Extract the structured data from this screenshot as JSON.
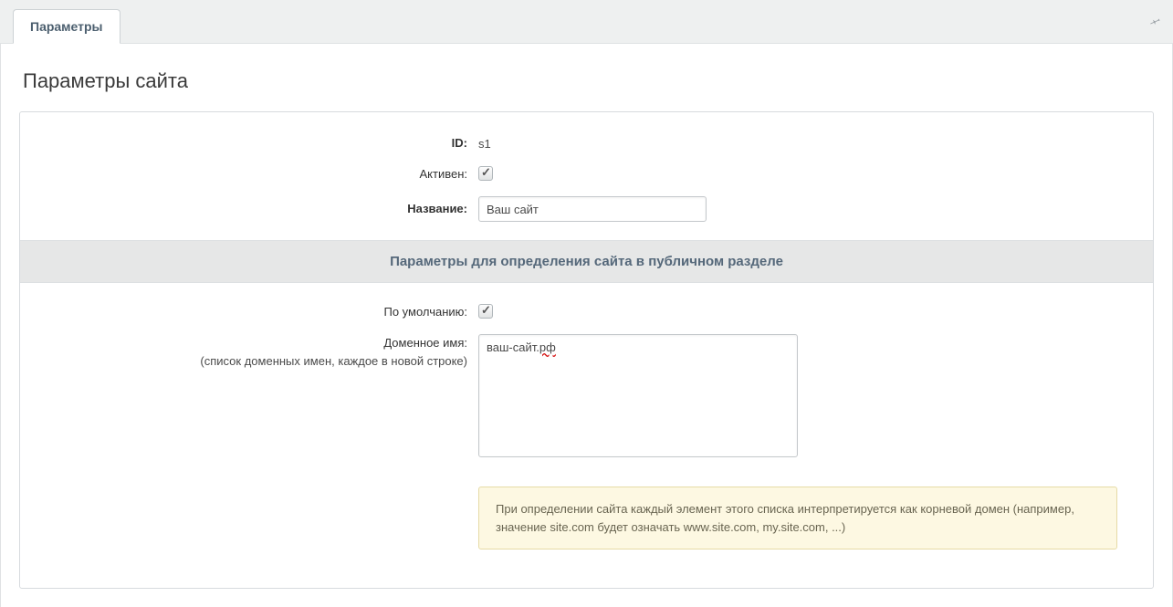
{
  "tabs": {
    "active": "Параметры"
  },
  "page": {
    "title": "Параметры сайта"
  },
  "fields": {
    "id_label": "ID:",
    "id_value": "s1",
    "active_label": "Активен:",
    "name_label": "Название:",
    "name_value": "Ваш сайт",
    "section_heading": "Параметры для определения сайта в публичном разделе",
    "default_label": "По умолчанию:",
    "domain_label": "Доменное имя:",
    "domain_sublabel": "(список доменных имен, каждое в новой строке)",
    "domain_value": "ваш-сайт.рф",
    "domain_note": "При определении сайта каждый элемент этого списка интерпретируется как корневой домен (например, значение site.com будет означать www.site.com, my.site.com, ...)"
  }
}
